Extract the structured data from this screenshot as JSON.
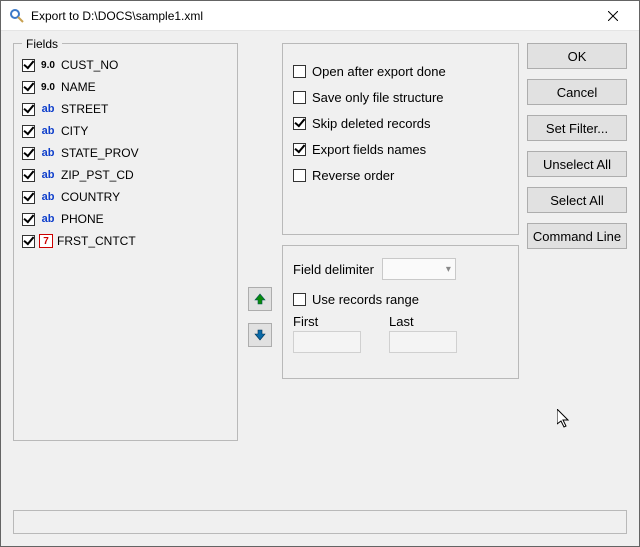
{
  "title": "Export to D:\\DOCS\\sample1.xml",
  "fieldsbox": {
    "title": "Fields"
  },
  "fields": [
    {
      "type": "num",
      "name": "CUST_NO",
      "checked": true
    },
    {
      "type": "num",
      "name": "NAME",
      "checked": true
    },
    {
      "type": "ab",
      "name": "STREET",
      "checked": true
    },
    {
      "type": "ab",
      "name": "CITY",
      "checked": true
    },
    {
      "type": "ab",
      "name": "STATE_PROV",
      "checked": true
    },
    {
      "type": "ab",
      "name": "ZIP_PST_CD",
      "checked": true
    },
    {
      "type": "ab",
      "name": "COUNTRY",
      "checked": true
    },
    {
      "type": "ab",
      "name": "PHONE",
      "checked": true
    },
    {
      "type": "date",
      "name": "FRST_CNTCT",
      "checked": true
    }
  ],
  "type_glyph": {
    "num": "9.0",
    "ab": "ab",
    "date": "7"
  },
  "options": [
    {
      "label": "Open after export done",
      "checked": false
    },
    {
      "label": "Save only file structure",
      "checked": false
    },
    {
      "label": "Skip deleted records",
      "checked": true
    },
    {
      "label": "Export fields names",
      "checked": true
    },
    {
      "label": "Reverse order",
      "checked": false
    }
  ],
  "delim": {
    "label": "Field delimiter",
    "use_range_label": "Use records range",
    "use_range_checked": false,
    "first_label": "First",
    "last_label": "Last"
  },
  "buttons": {
    "ok": "OK",
    "cancel": "Cancel",
    "setfilter": "Set Filter...",
    "unselect": "Unselect All",
    "select": "Select All",
    "cmdline": "Command Line"
  }
}
